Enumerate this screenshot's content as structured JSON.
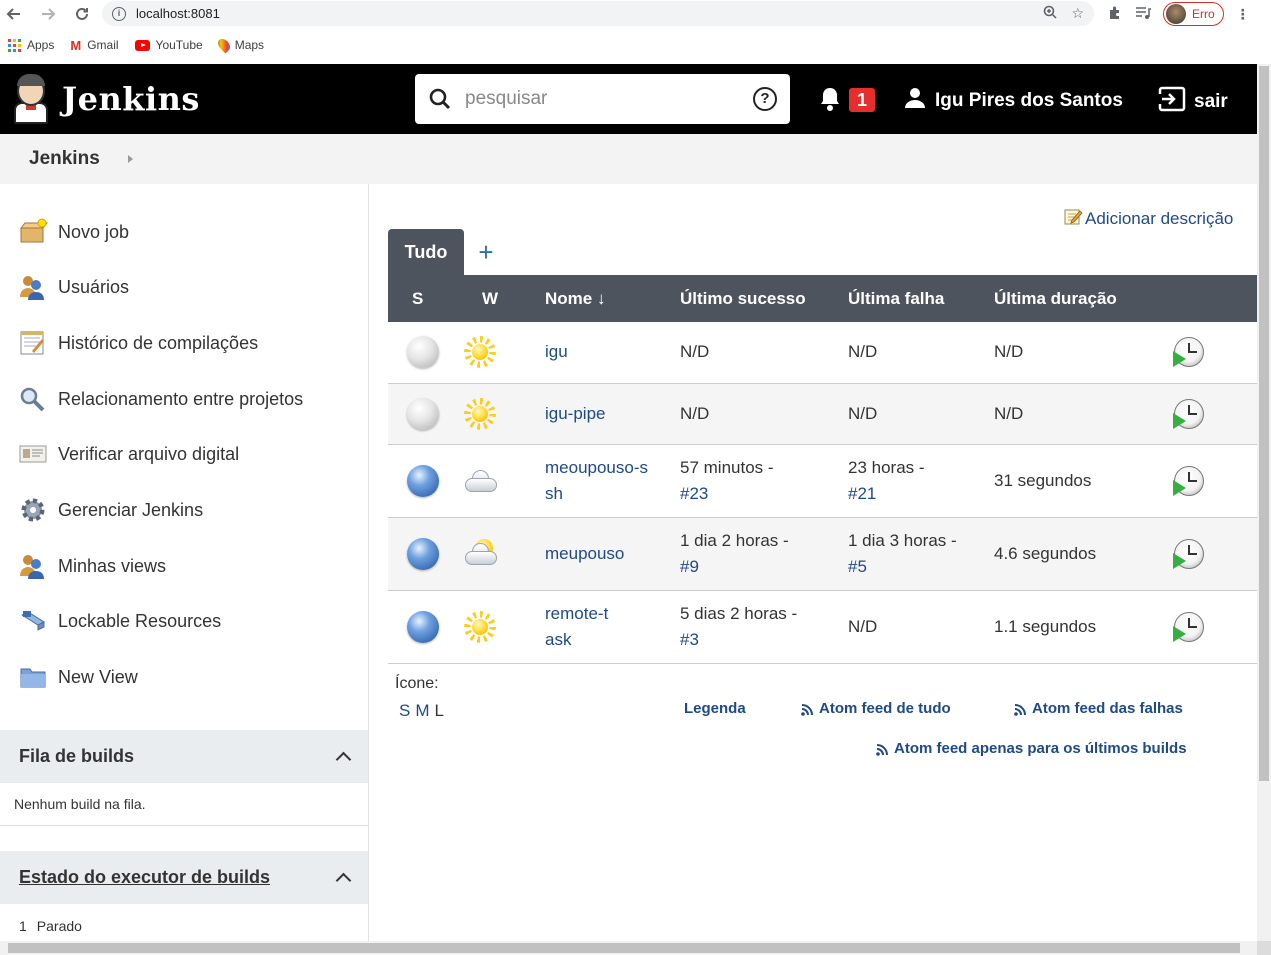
{
  "browser": {
    "url": "localhost:8081",
    "profile_status": "Erro",
    "bookmarks": [
      {
        "label": "Apps"
      },
      {
        "label": "Gmail"
      },
      {
        "label": "YouTube"
      },
      {
        "label": "Maps"
      }
    ]
  },
  "header": {
    "logo_text": "Jenkins",
    "search_placeholder": "pesquisar",
    "notification_count": "1",
    "user_name": "Igu Pires dos Santos",
    "logout_label": "sair"
  },
  "breadcrumb": {
    "root": "Jenkins"
  },
  "sidebar": {
    "tasks": [
      {
        "label": "Novo job",
        "icon": "new-package-icon"
      },
      {
        "label": "Usuários",
        "icon": "users-icon"
      },
      {
        "label": "Histórico de compilações",
        "icon": "notepad-icon"
      },
      {
        "label": "Relacionamento entre projetos",
        "icon": "search-icon"
      },
      {
        "label": "Verificar arquivo digital",
        "icon": "fingerprint-icon"
      },
      {
        "label": "Gerenciar Jenkins",
        "icon": "gear-icon"
      },
      {
        "label": "Minhas views",
        "icon": "users-icon"
      },
      {
        "label": "Lockable Resources",
        "icon": "lock-resource-icon"
      },
      {
        "label": "New View",
        "icon": "folder-icon"
      }
    ],
    "build_queue": {
      "title": "Fila de builds",
      "empty": "Nenhum build na fila."
    },
    "executors": {
      "title": "Estado do executor de builds",
      "row_number": "1",
      "row_status": "Parado"
    }
  },
  "main": {
    "add_description": "Adicionar descrição",
    "tabs": [
      {
        "label": "Tudo",
        "active": true
      }
    ],
    "add_tab_label": "+",
    "columns": {
      "s": "S",
      "w": "W",
      "name": "Nome ↓",
      "last_success": "Último sucesso",
      "last_failure": "Última falha",
      "last_duration": "Última duração"
    },
    "jobs": [
      {
        "status": "grey",
        "weather": "sunny",
        "name": "igu",
        "last_success": "N/D",
        "last_success_build": "",
        "last_failure": "N/D",
        "last_failure_build": "",
        "last_duration": "N/D"
      },
      {
        "status": "grey",
        "weather": "sunny",
        "name": "igu-pipe",
        "last_success": "N/D",
        "last_success_build": "",
        "last_failure": "N/D",
        "last_failure_build": "",
        "last_duration": "N/D"
      },
      {
        "status": "blue",
        "weather": "cloudy",
        "name": "meoupouso-ssh",
        "last_success": "57 minutos -",
        "last_success_build": "#23",
        "last_failure": "23 horas -",
        "last_failure_build": "#21",
        "last_duration": "31 segundos"
      },
      {
        "status": "blue",
        "weather": "partly-cloudy",
        "name": "meupouso",
        "last_success": "1 dia 2 horas -",
        "last_success_build": "#9",
        "last_failure": "1 dia 3 horas -",
        "last_failure_build": "#5",
        "last_duration": "4.6 segundos"
      },
      {
        "status": "blue",
        "weather": "sunny",
        "name": "remote-task",
        "last_success": "5 dias 2 horas -",
        "last_success_build": "#3",
        "last_failure": "N/D",
        "last_failure_build": "",
        "last_duration": "1.1 segundos"
      }
    ],
    "icon_label": "Ícone:",
    "icon_sizes": [
      "S",
      "M",
      "L"
    ],
    "legend": "Legenda",
    "feeds": {
      "all": "Atom feed de tudo",
      "failures": "Atom feed das falhas",
      "latest": "Atom feed apenas para os últimos builds"
    }
  }
}
